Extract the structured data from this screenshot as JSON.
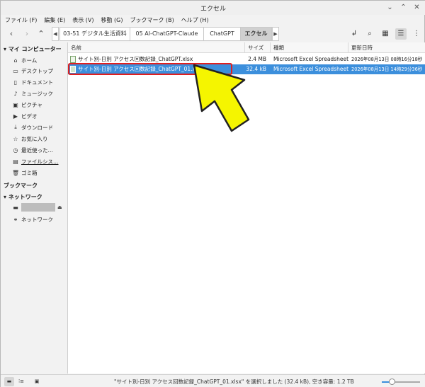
{
  "window": {
    "title": "エクセル",
    "controls": [
      "⌄",
      "⌃",
      "✕"
    ]
  },
  "menubar": [
    "ファイル (F)",
    "編集 (E)",
    "表示 (V)",
    "移動 (G)",
    "ブックマーク (B)",
    "ヘルプ (H)"
  ],
  "toolbar": {
    "crumbs": [
      {
        "label": "03-51 デジタル生活資料",
        "active": false
      },
      {
        "label": "05 AI-ChatGPT-Claude",
        "active": false
      },
      {
        "label": "ChatGPT",
        "active": false
      },
      {
        "label": "エクセル",
        "active": true
      }
    ],
    "view_mode": "list"
  },
  "sidebar": {
    "my_computer": "マイ コンピューター",
    "places": [
      {
        "label": "ホーム",
        "icon": "home-icon"
      },
      {
        "label": "デスクトップ",
        "icon": "desktop-icon"
      },
      {
        "label": "ドキュメント",
        "icon": "document-icon"
      },
      {
        "label": "ミュージック",
        "icon": "music-icon"
      },
      {
        "label": "ピクチャ",
        "icon": "picture-icon"
      },
      {
        "label": "ビデオ",
        "icon": "video-icon"
      },
      {
        "label": "ダウンロード",
        "icon": "download-icon"
      },
      {
        "label": "お気に入り",
        "icon": "star-icon"
      },
      {
        "label": "最近使った…",
        "icon": "recent-icon"
      },
      {
        "label": "ファイルシス…",
        "icon": "filesystem-icon"
      },
      {
        "label": "ゴミ箱",
        "icon": "trash-icon"
      }
    ],
    "bookmarks": "ブックマーク",
    "network": "ネットワーク",
    "network_items": [
      {
        "label": "ネットワーク",
        "icon": "network-icon"
      }
    ]
  },
  "filelist": {
    "columns": [
      "名前",
      "サイズ",
      "種類",
      "更新日時"
    ],
    "rows": [
      {
        "name": "サイト別-日別 アクセス回数記録_ChatGPT.xlsx",
        "size": "2.4 MB",
        "type": "Microsoft Excel Spreadsheet",
        "modified": "2026年08月13日 08時16分18秒",
        "selected": false
      },
      {
        "name": "サイト別-日別 アクセス回数記録_ChatGPT_01.xlsx",
        "size": "32.4 kB",
        "type": "Microsoft Excel Spreadsheet",
        "modified": "2026年08月13日 14時29分36秒",
        "selected": true
      }
    ]
  },
  "statusbar": {
    "text": "\"サイト別-日別 アクセス回数記録_ChatGPT_01.xlsx\" を選択しました (32.4 kB), 空き容量: 1.2 TB",
    "zoom_fraction": 0.25
  },
  "colors": {
    "selection": "#3c8fdc",
    "highlight_box": "#e01f1f",
    "arrow_fill": "#f5f500"
  }
}
